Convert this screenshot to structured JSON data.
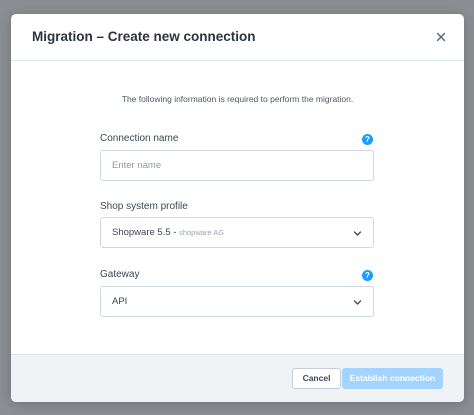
{
  "modal": {
    "title": "Migration – Create new connection",
    "close_icon": "close-icon"
  },
  "intro": {
    "text": "The following information is required to perform the migration."
  },
  "fields": {
    "connection_name": {
      "label": "Connection name",
      "placeholder": "Enter name",
      "value": "",
      "help_icon": "help-icon"
    },
    "shop_system_profile": {
      "label": "Shop system profile",
      "value": "Shopware 5.5 -",
      "sub_value": "shopware AG",
      "icon": "chevron-down-icon"
    },
    "gateway": {
      "label": "Gateway",
      "value": "API",
      "help_icon": "help-icon",
      "icon": "chevron-down-icon"
    }
  },
  "footer": {
    "cancel_label": "Cancel",
    "submit_label": "Establish connection",
    "submit_state": "disabled"
  },
  "colors": {
    "accent": "#189eff",
    "accent_disabled": "#a3d4ff",
    "overlay": "#8a8d91"
  }
}
